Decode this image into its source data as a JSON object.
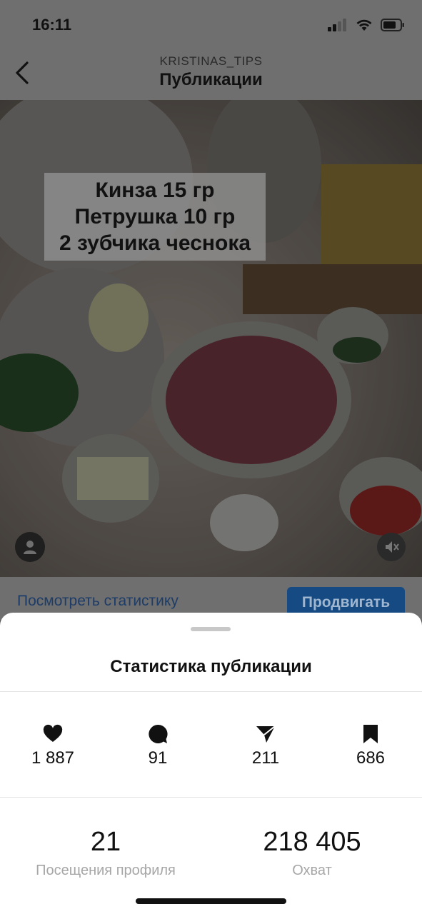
{
  "status_bar": {
    "time": "16:11"
  },
  "header": {
    "username": "KRISTINAS_TIPS",
    "title": "Публикации"
  },
  "photo": {
    "overlay_lines": [
      "Кинза 15 гр",
      "Петрушка 10 гр",
      "2 зубчика чеснока"
    ]
  },
  "actions": {
    "view_stats": "Посмотреть статистику",
    "promote": "Продвигать"
  },
  "sheet": {
    "title": "Статистика публикации",
    "metrics": [
      {
        "icon": "heart-icon",
        "value": "1 887"
      },
      {
        "icon": "comment-icon",
        "value": "91"
      },
      {
        "icon": "send-icon",
        "value": "211"
      },
      {
        "icon": "bookmark-icon",
        "value": "686"
      }
    ],
    "summary": [
      {
        "value": "21",
        "label": "Посещения профиля"
      },
      {
        "value": "218 405",
        "label": "Охват"
      }
    ]
  },
  "colors": {
    "link": "#1d3c68",
    "promote_bg": "#164a82",
    "muted_label": "#a6a6a6"
  }
}
